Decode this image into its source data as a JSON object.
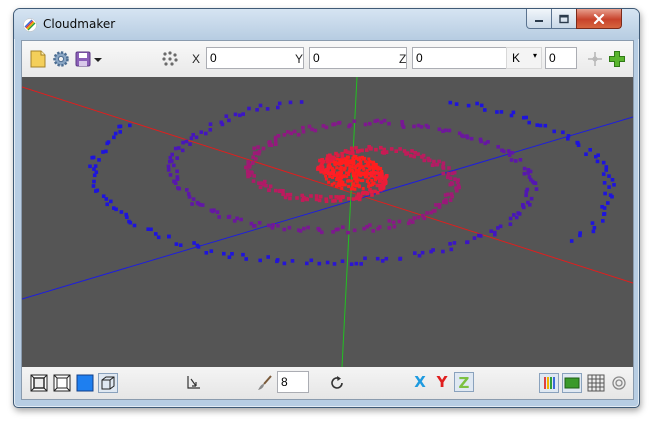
{
  "window": {
    "title": "Cloudmaker"
  },
  "toolbar": {
    "x_label": "X",
    "x_value": "0",
    "y_label": "Y",
    "y_value": "0",
    "z_label": "Z",
    "z_value": "0",
    "k_label": "K",
    "k_selected": "−",
    "k_value": "0",
    "icons": [
      "new-file-icon",
      "settings-gear-icon",
      "save-icon",
      "dropdown-arrow-icon",
      "points-cloud-icon",
      "crosshair-icon",
      "add-plus-icon"
    ]
  },
  "bottom_toolbar": {
    "point_size": "8",
    "x_axis_label": "X",
    "y_axis_label": "Y",
    "z_axis_label": "Z",
    "icons": [
      "frame-outer-icon",
      "frame-inner-icon",
      "solid-fill-icon",
      "cube-view-icon",
      "transform-icon",
      "brush-icon",
      "rotate-icon",
      "color-bars-icon",
      "panel-view-icon",
      "grid-icon",
      "target-icon"
    ]
  },
  "colors": {
    "viewport_bg": "#555555",
    "x_axis_color": "#1e9be0",
    "y_axis_color": "#e01e1e",
    "z_axis_color": "#7cc142",
    "point_core": "#ff1e1e",
    "point_outer": "#1e1edc"
  }
}
